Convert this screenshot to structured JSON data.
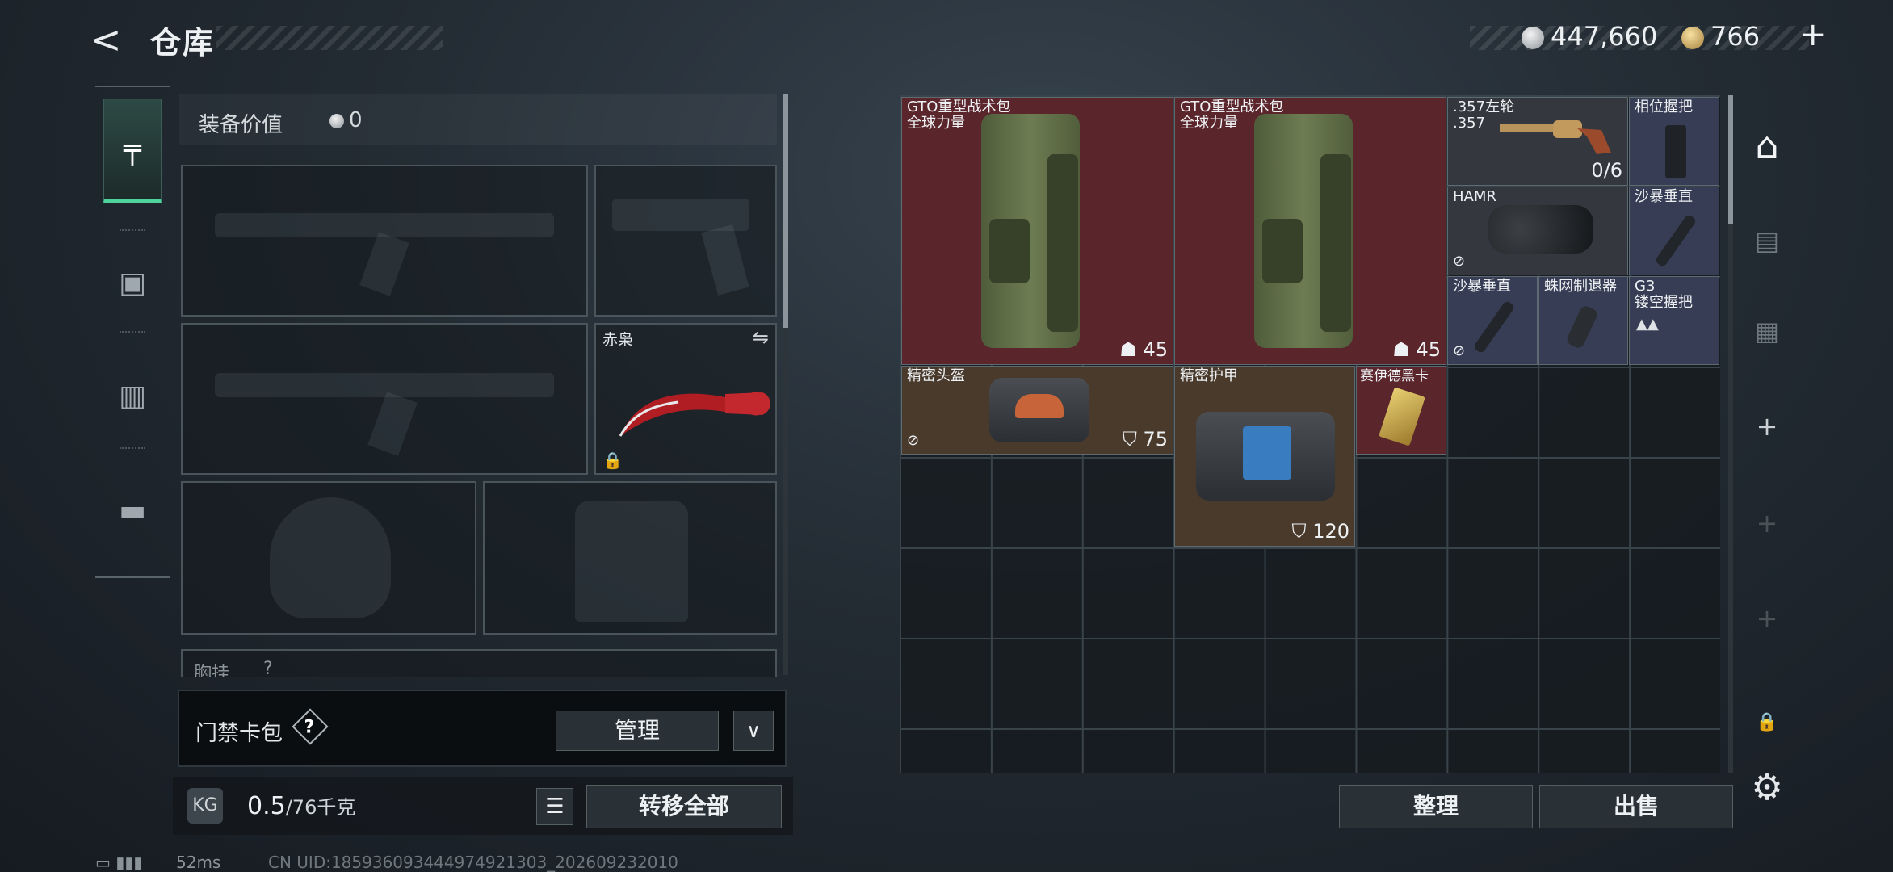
{
  "header": {
    "title": "仓库",
    "currency_silver": "447,660",
    "currency_gold": "766"
  },
  "left_nav": {
    "items": [
      {
        "name": "pistol-icon",
        "glyph": "╤"
      },
      {
        "name": "backpack-icon",
        "glyph": "▣"
      },
      {
        "name": "vest-icon",
        "glyph": "▥"
      },
      {
        "name": "toolbox-icon",
        "glyph": "▬"
      }
    ]
  },
  "equipment": {
    "value_label": "装备价值",
    "value": "0",
    "melee_name": "赤枭",
    "chest_label": "胸挂",
    "chest_label_suffix": "?"
  },
  "keycard": {
    "label": "门禁卡包",
    "help": "?",
    "manage_label": "管理"
  },
  "weight": {
    "current": "0.5",
    "max": "/76千克",
    "icon_text": "KG"
  },
  "buttons": {
    "transfer_all": "转移全部",
    "sort": "整理",
    "sell": "出售"
  },
  "storage_items": [
    {
      "id": "bp1",
      "name": "GTO重型战术包",
      "sub": "全球力量",
      "stat": "45",
      "stat_icon": "backpack"
    },
    {
      "id": "bp2",
      "name": "GTO重型战术包",
      "sub": "全球力量",
      "stat": "45",
      "stat_icon": "backpack"
    },
    {
      "id": "revolver",
      "name": ".357左轮",
      "sub": ".357",
      "stat": "0/6"
    },
    {
      "id": "grip1",
      "name": "相位握把"
    },
    {
      "id": "hamr",
      "name": "HAMR"
    },
    {
      "id": "supp1",
      "name": "沙暴垂直"
    },
    {
      "id": "supp2",
      "name": "沙暴垂直"
    },
    {
      "id": "spider",
      "name": "蛛网制退器"
    },
    {
      "id": "g3grip",
      "name": "G3",
      "sub": "镂空握把"
    },
    {
      "id": "helmet",
      "name": "精密头盔",
      "stat": "75"
    },
    {
      "id": "armor",
      "name": "精密护甲",
      "stat": "120"
    },
    {
      "id": "card",
      "name": "赛伊德黑卡"
    }
  ],
  "footer": {
    "ping": "52ms",
    "uid": "CN UID:185936093444974921303_202609232010"
  }
}
